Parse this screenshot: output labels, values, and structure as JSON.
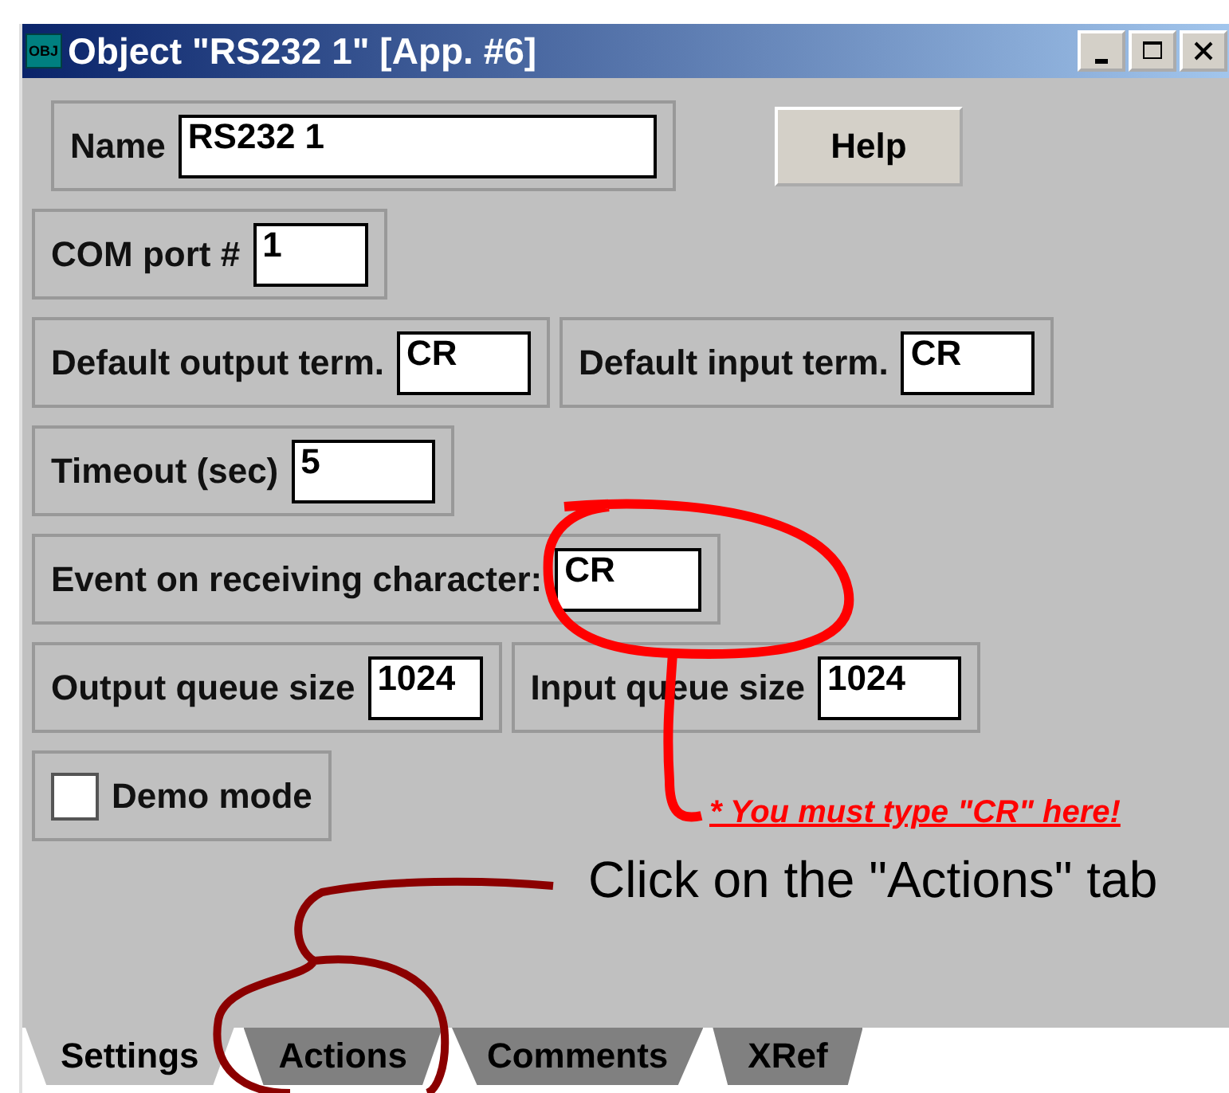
{
  "window": {
    "title": "Object \"RS232 1\" [App. #6]",
    "icon_text": "OBJ"
  },
  "rows": [
    {
      "groups": [
        {
          "kind": "field",
          "label": "Name",
          "value": "RS232 1"
        }
      ],
      "button": "Help"
    },
    {
      "groups": [
        {
          "kind": "field",
          "label": "COM port #",
          "value": "1"
        }
      ]
    },
    {
      "groups": [
        {
          "kind": "field",
          "label": "Default output term.",
          "value": "CR"
        },
        {
          "kind": "field",
          "label": "Default input term.",
          "value": "CR"
        }
      ]
    },
    {
      "groups": [
        {
          "kind": "field",
          "label": "Timeout (sec)",
          "value": "5"
        }
      ]
    },
    {
      "groups": [
        {
          "kind": "field",
          "label": "Event on receiving character:",
          "value": "CR"
        }
      ]
    },
    {
      "groups": [
        {
          "kind": "field",
          "label": "Output queue size",
          "value": "1024"
        },
        {
          "kind": "field",
          "label": "Input queue size",
          "value": "1024"
        }
      ]
    },
    {
      "groups": [
        {
          "kind": "checkbox",
          "label": "Demo mode",
          "checked": false
        }
      ]
    }
  ],
  "annotations": {
    "note": "* You must type \"CR\" here!",
    "instruction": "Click on the \"Actions\" tab"
  },
  "tabs": [
    {
      "label": "Settings",
      "selected": true
    },
    {
      "label": "Actions",
      "selected": false
    },
    {
      "label": "Comments",
      "selected": false
    },
    {
      "label": "XRef",
      "selected": false
    }
  ]
}
